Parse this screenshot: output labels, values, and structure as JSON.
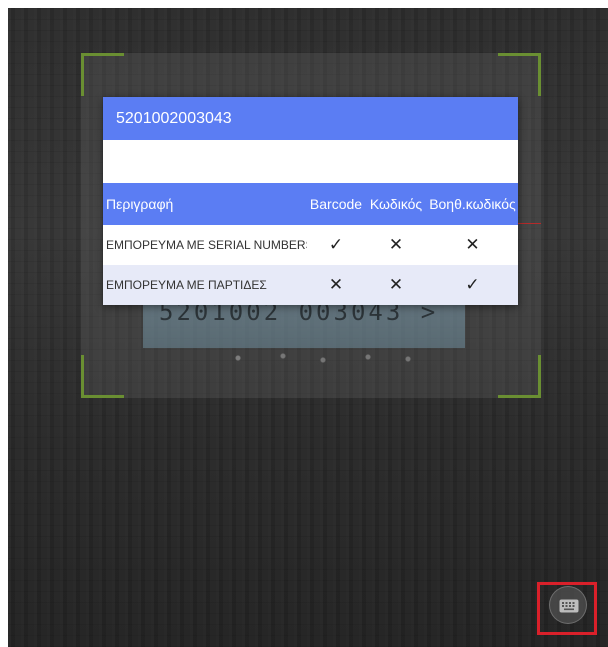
{
  "scanned_label_text": "5201002 003043 >",
  "dialog": {
    "title": "5201002003043",
    "input_value": "",
    "columns": {
      "description": "Περιγραφή",
      "barcode": "Barcode",
      "code": "Κωδικός",
      "aux_code": "Βοηθ.κωδικός"
    },
    "rows": [
      {
        "description": "ΕΜΠΟΡΕΥΜΑ ΜΕ SERIAL NUMBERS",
        "barcode": "✓",
        "code": "✕",
        "aux_code": "✕"
      },
      {
        "description": "ΕΜΠΟΡΕΥΜΑ ΜΕ ΠΑΡΤΙΔΕΣ",
        "barcode": "✕",
        "code": "✕",
        "aux_code": "✓"
      }
    ]
  },
  "keyboard_button": {
    "icon": "keyboard-icon"
  },
  "colors": {
    "accent": "#5b7df3",
    "row_alt": "#e7eaf8",
    "scan_corner": "#6a8f32",
    "highlight_frame": "#d9202a"
  }
}
